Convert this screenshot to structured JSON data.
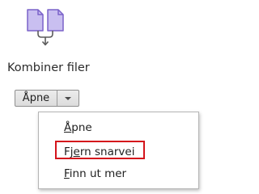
{
  "tool": {
    "icon": "combine-files-icon",
    "title": "Kombiner filer",
    "icon_color": "#8a6fd1"
  },
  "split_button": {
    "label": "Åpne",
    "arrow_icon": "chevron-down-icon"
  },
  "menu": {
    "items": [
      {
        "pre": "",
        "mnemonic": "Å",
        "post": "pne"
      },
      {
        "pre": "Fj",
        "mnemonic": "e",
        "post": "rn snarvei"
      },
      {
        "pre": "",
        "mnemonic": "F",
        "post": "inn ut mer"
      }
    ],
    "highlight_color": "#d4141c"
  }
}
